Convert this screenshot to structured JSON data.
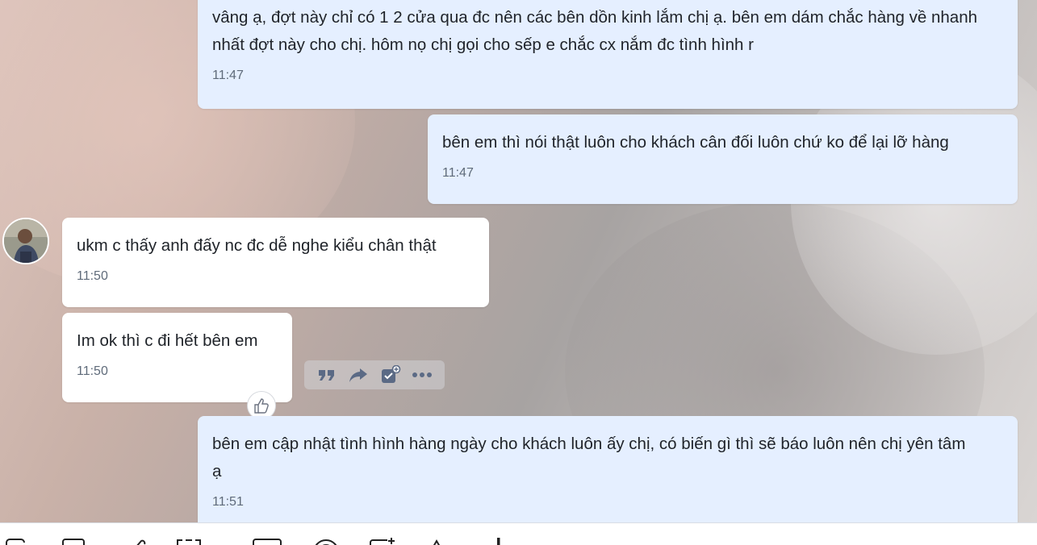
{
  "chat": {
    "messages": [
      {
        "sender": "me",
        "text": "vâng ạ, đợt này chỉ có 1 2 cửa qua đc nên các bên dồn kinh lắm chị ạ. bên em dám chắc hàng về nhanh nhất đợt này cho chị. hôm nọ chị gọi cho sếp e chắc cx nắm đc tình hình r",
        "time": "11:47"
      },
      {
        "sender": "me",
        "text": "bên em thì nói thật luôn cho khách cân đối luôn chứ ko để lại lỡ hàng",
        "time": "11:47"
      },
      {
        "sender": "them",
        "text": "ukm c thấy anh đấy nc đc dễ nghe kiểu chân thật",
        "time": "11:50"
      },
      {
        "sender": "them",
        "text": "Im ok thì c đi hết bên em",
        "time": "11:50"
      },
      {
        "sender": "me",
        "text": "bên em cập nhật tình hình hàng ngày cho khách luôn ấy chị, có biến gì thì sẽ báo luôn nên chị yên tâm ạ",
        "time": "11:51"
      }
    ]
  },
  "hover_actions": [
    "quote-icon",
    "forward-icon",
    "create-task-icon",
    "more-icon"
  ],
  "reaction": "thumbs-up-icon",
  "toolbar": {
    "icons": [
      "sticker-icon",
      "image-icon",
      "attach-icon",
      "screenshot-icon",
      "business-card-icon",
      "mention-icon",
      "reminder-icon",
      "text-format-icon",
      "more-options-icon"
    ]
  },
  "colors": {
    "my_bubble": "#e5efff",
    "their_bubble": "#ffffff",
    "time_text": "#5f6b7a",
    "action_icon": "#5b6a85"
  }
}
